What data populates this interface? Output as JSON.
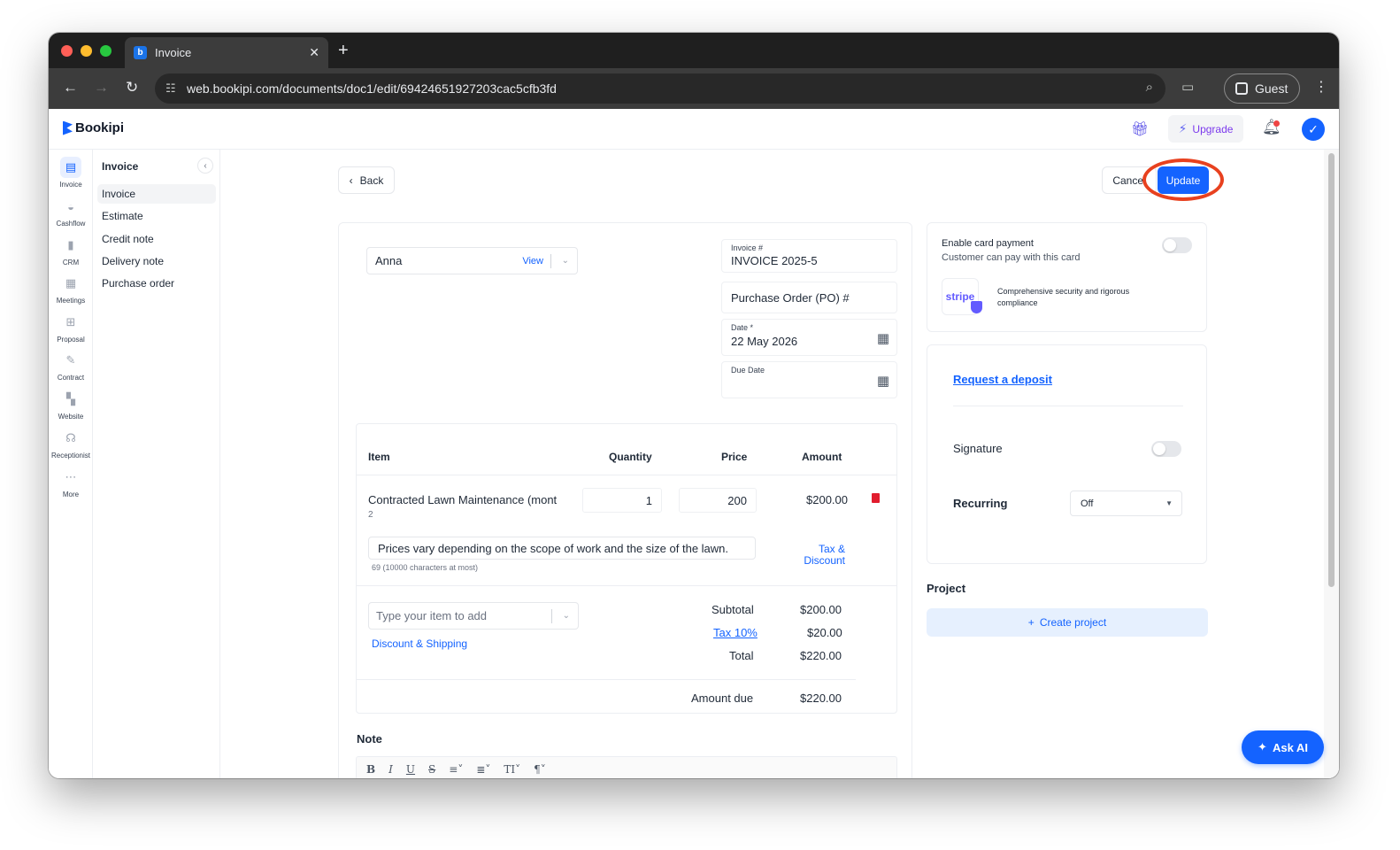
{
  "browser": {
    "tab_title": "Invoice",
    "url": "web.bookipi.com/documents/doc1/edit/69424651927203cac5cfb3fd",
    "profile_label": "Guest"
  },
  "app": {
    "brand": "Bookipi",
    "upgrade_label": "Upgrade"
  },
  "rail": {
    "items": [
      {
        "label": "Invoice",
        "icon": "invoice-icon"
      },
      {
        "label": "Cashflow",
        "icon": "cashflow-icon"
      },
      {
        "label": "CRM",
        "icon": "crm-icon"
      },
      {
        "label": "Meetings",
        "icon": "meetings-icon"
      },
      {
        "label": "Proposal",
        "icon": "proposal-icon"
      },
      {
        "label": "Contract",
        "icon": "contract-icon"
      },
      {
        "label": "Website",
        "icon": "website-icon"
      },
      {
        "label": "Receptionist",
        "icon": "headset-icon"
      },
      {
        "label": "More",
        "icon": "more-icon"
      }
    ]
  },
  "subnav": {
    "heading": "Invoice",
    "items": [
      "Invoice",
      "Estimate",
      "Credit note",
      "Delivery note",
      "Purchase order"
    ]
  },
  "actions": {
    "back": "Back",
    "cancel": "Cancel",
    "update": "Update"
  },
  "document": {
    "client": "Anna",
    "client_view": "View",
    "invoice_number_label": "Invoice #",
    "invoice_number": "INVOICE 2025-5",
    "po_placeholder": "Purchase Order (PO) #",
    "date_label": "Date *",
    "date": "22 May 2026",
    "due_date_label": "Due Date"
  },
  "items_table": {
    "headers": {
      "item": "Item",
      "quantity": "Quantity",
      "price": "Price",
      "amount": "Amount"
    },
    "rows": [
      {
        "name": "Contracted Lawn Maintenance (mont",
        "sub": "2",
        "quantity": "1",
        "price": "200",
        "amount": "$200.00",
        "description": "Prices vary depending on the scope of work and the size of the lawn.",
        "char_count": "69 (10000 characters at most)",
        "tax_link_1": "Tax &",
        "tax_link_2": "Discount"
      }
    ],
    "add_item_placeholder": "Type your item to add",
    "discount_shipping": "Discount & Shipping"
  },
  "totals": {
    "subtotal_label": "Subtotal",
    "subtotal": "$200.00",
    "tax_label": "Tax 10%",
    "tax": "$20.00",
    "total_label": "Total",
    "total": "$220.00",
    "amount_due_label": "Amount due",
    "amount_due": "$220.00"
  },
  "note": {
    "label": "Note",
    "toolbar": [
      "B",
      "I",
      "U",
      "S",
      "≡˅",
      "≣˅",
      "TI˅",
      "¶˅"
    ]
  },
  "right_panel": {
    "card_payment_title": "Enable card payment",
    "card_payment_sub": "Customer can pay with this card",
    "stripe_logo": "stripe",
    "stripe_text": "Comprehensive security and rigorous compliance",
    "request_deposit": "Request a deposit",
    "signature": "Signature",
    "recurring": "Recurring",
    "recurring_value": "Off",
    "project_label": "Project",
    "create_project": "Create project"
  },
  "ask_ai": "Ask AI",
  "colors": {
    "accent": "#1463ff",
    "highlight": "#e8411f",
    "danger": "#e11d2e"
  }
}
